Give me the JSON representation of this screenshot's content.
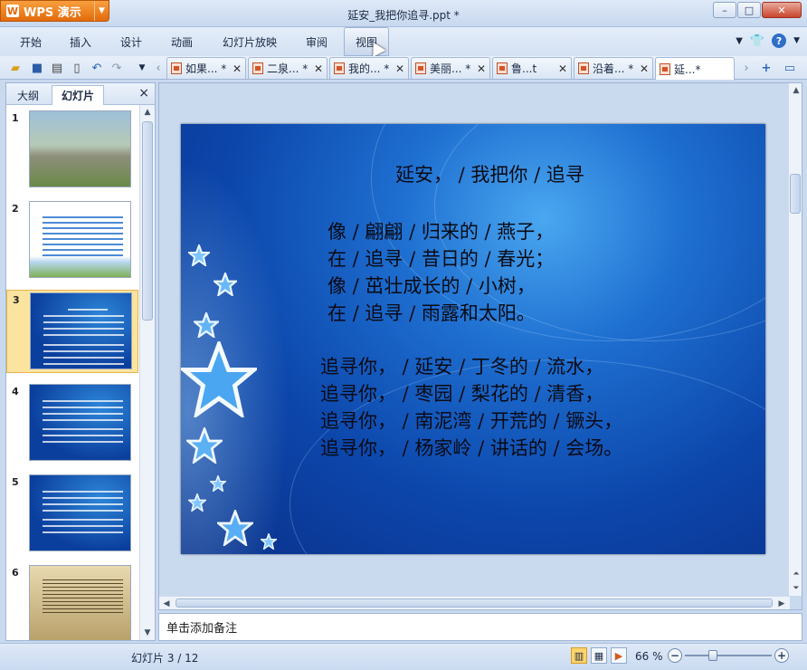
{
  "app": {
    "brand_label": "WPS 演示",
    "window_title": "延安_我把你追寻.ppt *",
    "controls": [
      "–",
      "□",
      "✕"
    ]
  },
  "menu": {
    "tabs": [
      "开始",
      "插入",
      "设计",
      "动画",
      "幻灯片放映",
      "审阅",
      "视图"
    ],
    "hovered": "视图"
  },
  "doc_tabs": [
    {
      "label": "如果... *",
      "active": false
    },
    {
      "label": "二泉... *",
      "active": false
    },
    {
      "label": "我的... *",
      "active": false
    },
    {
      "label": "美丽... *",
      "active": false
    },
    {
      "label": "鲁...t",
      "active": false
    },
    {
      "label": "沿着... *",
      "active": false
    },
    {
      "label": "延...*",
      "active": true
    }
  ],
  "left_pane": {
    "tabs": [
      "大纲",
      "幻灯片"
    ],
    "active_tab": "幻灯片",
    "close_label": "×",
    "thumbnails": [
      {
        "num": "1",
        "style": "city"
      },
      {
        "num": "2",
        "style": "white"
      },
      {
        "num": "3",
        "style": "blue",
        "selected": true
      },
      {
        "num": "4",
        "style": "blue"
      },
      {
        "num": "5",
        "style": "blue"
      },
      {
        "num": "6",
        "style": "old"
      }
    ]
  },
  "slide": {
    "title": "延安， / 我把你 / 追寻",
    "stanza1": [
      "像 / 翩翩 / 归来的 / 燕子，",
      "在 / 追寻 / 昔日的 / 春光；",
      "像 / 茁壮成长的 / 小树，",
      "在 / 追寻 / 雨露和太阳。"
    ],
    "stanza2": [
      "追寻你， / 延安 / 丁冬的 / 流水，",
      "追寻你， / 枣园 / 梨花的 / 清香，",
      "追寻你， / 南泥湾 / 开荒的 / 镢头，",
      "追寻你， / 杨家岭 / 讲话的 / 会场。"
    ]
  },
  "notes": {
    "placeholder": "单击添加备注"
  },
  "status": {
    "slide_indicator": "幻灯片 3 / 12",
    "zoom": "66 %"
  },
  "colors": {
    "accent_orange": "#e36a0a",
    "slide_blue": "#0c46ab",
    "selection": "#fbe4a0"
  }
}
